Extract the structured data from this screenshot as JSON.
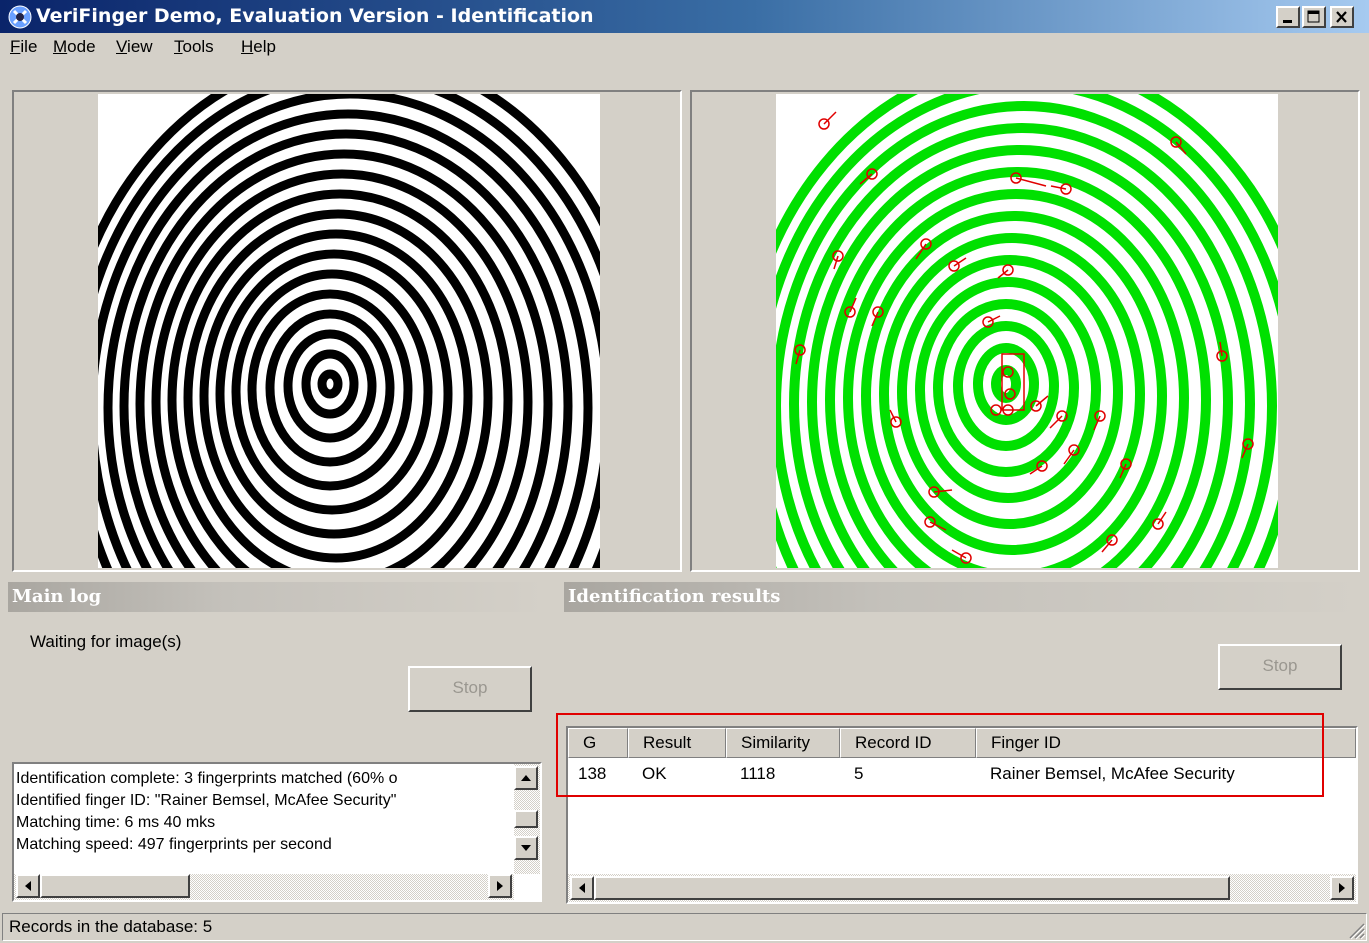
{
  "window": {
    "title": "VeriFinger Demo, Evaluation Version - Identification",
    "minimize_icon": "minimize-icon",
    "maximize_icon": "maximize-icon",
    "close_icon": "close-icon"
  },
  "menu": [
    {
      "label": "File",
      "accel": "F",
      "rest": "ile"
    },
    {
      "label": "Mode",
      "accel": "M",
      "rest": "ode"
    },
    {
      "label": "View",
      "accel": "V",
      "rest": "iew"
    },
    {
      "label": "Tools",
      "accel": "T",
      "rest": "ools"
    },
    {
      "label": "Help",
      "accel": "H",
      "rest": "elp"
    }
  ],
  "main_log": {
    "header": "Main log",
    "status": "Waiting for image(s)",
    "stop_label": "Stop",
    "lines": [
      "Identification complete: 3 fingerprints matched (60% o",
      "Identified finger ID: \"Rainer Bemsel, McAfee Security\"",
      "Matching time: 6 ms 40 mks",
      "Matching speed: 497 fingerprints per second"
    ]
  },
  "results": {
    "header": "Identification results",
    "stop_label": "Stop",
    "columns": [
      "G",
      "Result",
      "Similarity",
      "Record ID",
      "Finger ID"
    ],
    "rows": [
      {
        "g": "138",
        "result": "OK",
        "similarity": "1118",
        "record_id": "5",
        "finger_id": "Rainer Bemsel, McAfee Security"
      }
    ],
    "highlight_color": "#e00000"
  },
  "status_bar": {
    "text": "Records in the database: 5"
  },
  "colors": {
    "titlebar": "#0a246a",
    "ridge_green": "#00e000",
    "minutiae_red": "#e00000"
  }
}
